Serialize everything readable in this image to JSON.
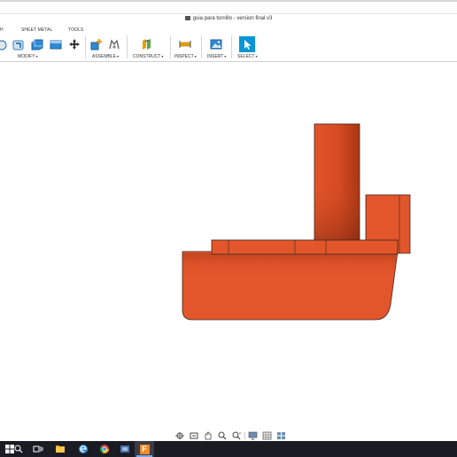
{
  "window": {
    "title": "guia para tornillo - version final v3"
  },
  "ribbon": {
    "tabs": [
      {
        "label": "H"
      },
      {
        "label": "SHEET METAL"
      },
      {
        "label": "TOOLS"
      }
    ],
    "groups": {
      "modify": "MODIFY",
      "assemble": "ASSEMBLE",
      "construct": "CONSTRUCT",
      "inspect": "INSPECT",
      "insert": "INSERT",
      "select": "SELECT"
    }
  },
  "model": {
    "body_color": "#e3552a",
    "edge_color": "#3a2a24"
  },
  "nav_toolbar": {
    "tools": [
      "orbit-icon",
      "look-at-icon",
      "pan-icon",
      "zoom-icon",
      "zoom-window-icon",
      "display-settings-icon",
      "grid-icon",
      "viewports-icon"
    ]
  },
  "taskbar": {
    "apps": [
      "start-icon",
      "search-icon",
      "task-view-icon",
      "file-explorer-icon",
      "mail-icon",
      "edge-icon",
      "chrome-icon",
      "folder-icon",
      "fusion-360-icon"
    ],
    "fusion_label": "F"
  },
  "colors": {
    "accent": "#0696d7",
    "taskbar": "#1b1b24"
  }
}
